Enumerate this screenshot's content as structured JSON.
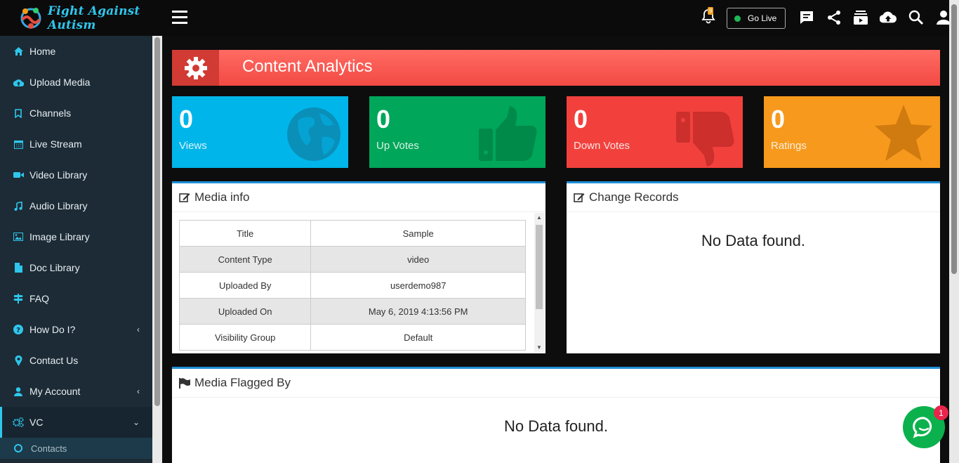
{
  "brand": {
    "name": "Fight Against Autism"
  },
  "sidebar": {
    "items": [
      {
        "label": "Home",
        "icon": "home-icon"
      },
      {
        "label": "Upload Media",
        "icon": "cloud-upload-icon"
      },
      {
        "label": "Channels",
        "icon": "bookmark-icon"
      },
      {
        "label": "Live Stream",
        "icon": "calendar-icon"
      },
      {
        "label": "Video Library",
        "icon": "video-camera-icon"
      },
      {
        "label": "Audio Library",
        "icon": "music-icon"
      },
      {
        "label": "Image Library",
        "icon": "image-icon"
      },
      {
        "label": "Doc Library",
        "icon": "file-icon"
      },
      {
        "label": "FAQ",
        "icon": "signpost-icon"
      },
      {
        "label": "How Do I?",
        "icon": "question-circle-icon"
      },
      {
        "label": "Contact Us",
        "icon": "map-marker-icon"
      },
      {
        "label": "My Account",
        "icon": "user-icon"
      },
      {
        "label": "VC",
        "icon": "cogs-icon"
      }
    ],
    "sub_item": "Contacts"
  },
  "topbar": {
    "notification_count": "9",
    "go_live_label": "Go Live"
  },
  "banner": {
    "title": "Content Analytics"
  },
  "stats": [
    {
      "value": "0",
      "label": "Views",
      "color": "#00b5e9"
    },
    {
      "value": "0",
      "label": "Up Votes",
      "color": "#00a65a"
    },
    {
      "value": "0",
      "label": "Down Votes",
      "color": "#f2413d"
    },
    {
      "value": "0",
      "label": "Ratings",
      "color": "#f7991c"
    }
  ],
  "media_info": {
    "title": "Media info",
    "rows": [
      {
        "key": "Title",
        "value": "Sample"
      },
      {
        "key": "Content Type",
        "value": "video"
      },
      {
        "key": "Uploaded By",
        "value": "userdemo987"
      },
      {
        "key": "Uploaded On",
        "value": "May 6, 2019 4:13:56 PM"
      },
      {
        "key": "Visibility Group",
        "value": "Default"
      }
    ]
  },
  "change_records": {
    "title": "Change Records",
    "empty": "No Data found."
  },
  "flagged": {
    "title": "Media Flagged By",
    "empty": "No Data found."
  },
  "chat": {
    "badge": "1"
  }
}
